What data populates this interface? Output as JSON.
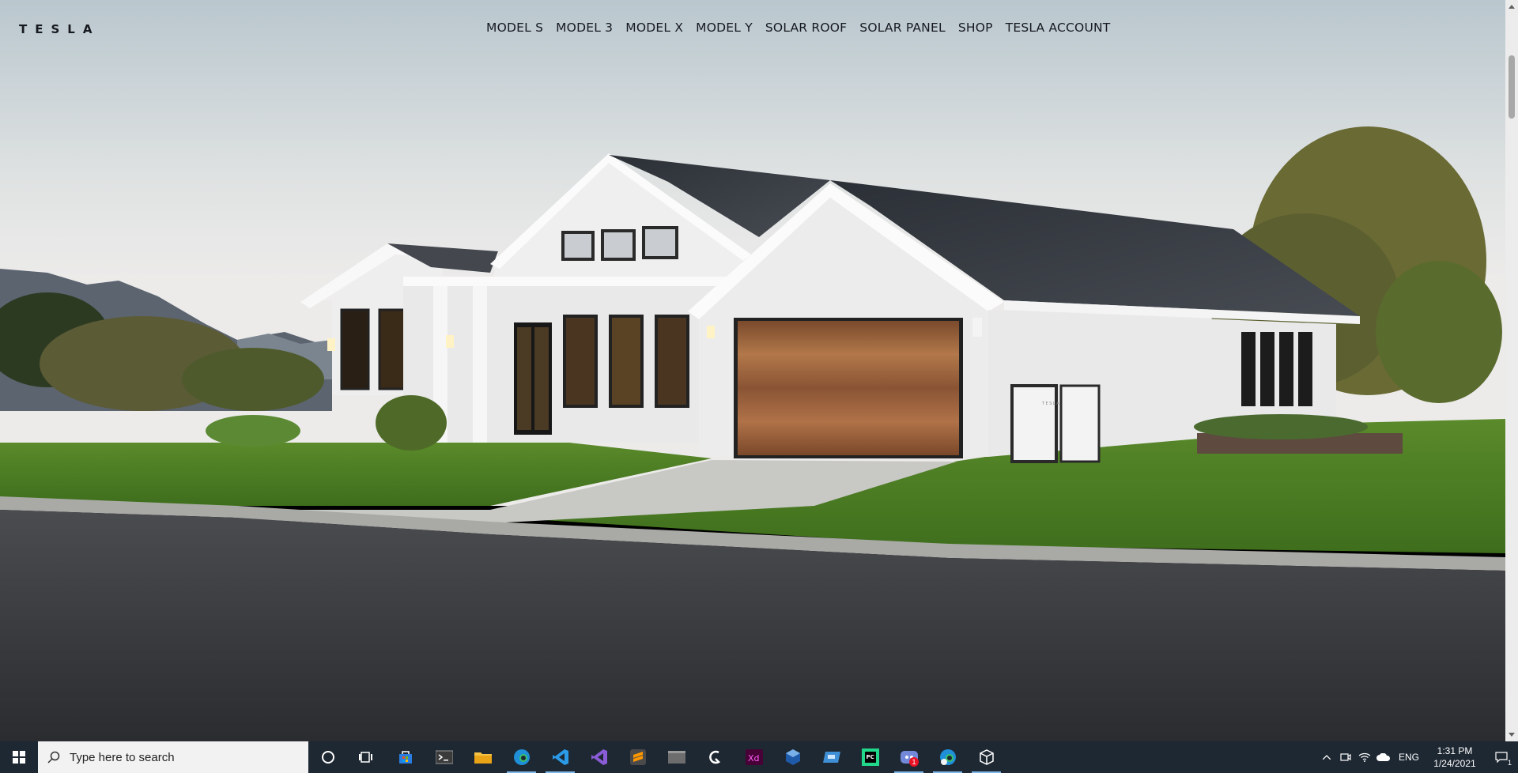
{
  "site": {
    "brand": "TESLA",
    "nav": [
      "MODEL S",
      "MODEL 3",
      "MODEL X",
      "MODEL Y",
      "SOLAR ROOF",
      "SOLAR PANEL",
      "SHOP",
      "TESLA ACCOUNT"
    ]
  },
  "hero": {
    "powerwall_label": "TESLA"
  },
  "taskbar": {
    "search_placeholder": "Type here to search",
    "apps": [
      "cortana-icon",
      "task-view-icon",
      "store-icon",
      "terminal-icon",
      "file-explorer-icon",
      "edge-icon",
      "vscode-icon",
      "visual-studio-icon",
      "sublime-icon",
      "window-icon",
      "app-icon",
      "xd-icon",
      "virtualbox-icon",
      "remote-desktop-icon",
      "pycharm-icon",
      "discord-icon",
      "edge-beta-icon",
      "box-icon"
    ],
    "discord_badge": "1",
    "language": "ENG",
    "time": "1:31 PM",
    "date": "1/24/2021",
    "notification_count": "1"
  },
  "colors": {
    "nav_text": "#171a20",
    "taskbar": "#1e2833",
    "active_indicator": "#7fb7e8"
  }
}
